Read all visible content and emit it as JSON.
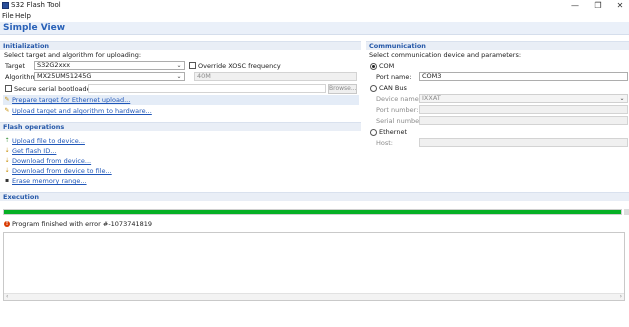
{
  "window": {
    "title": "S32 Flash Tool",
    "min": "—",
    "max": "❐",
    "close": "✕"
  },
  "menu": [
    {
      "label": "File"
    },
    {
      "label": "Help"
    }
  ],
  "view_title": "Simple View",
  "initialization": {
    "header": "Initialization",
    "subtitle": "Select target and algorithm for uploading:",
    "target_label": "Target",
    "target_value": "S32G2xxx",
    "override_label": "Override XOSC frequency",
    "override_checked": false,
    "algorithm_label": "Algorithm",
    "algorithm_value": "MX25UM51245G",
    "freq_value": "40M",
    "secure_label": "Secure serial bootloader:",
    "secure_checked": false,
    "browse_label": "Browse...",
    "link_ethernet": "Prepare target for Ethernet upload...",
    "link_upload": "Upload target and algorithm to hardware..."
  },
  "flash_operations": {
    "header": "Flash operations",
    "items": [
      {
        "label": "Upload file to device...",
        "icon": "upload-icon"
      },
      {
        "label": "Get flash ID...",
        "icon": "info-icon"
      },
      {
        "label": "Download from device...",
        "icon": "download-icon"
      },
      {
        "label": "Download from device to file...",
        "icon": "download-file-icon"
      },
      {
        "label": "Erase memory range...",
        "icon": "erase-icon"
      }
    ]
  },
  "communication": {
    "header": "Communication",
    "subtitle": "Select communication device and parameters:",
    "com_label": "COM",
    "com_selected": true,
    "port_name_label": "Port name:",
    "port_name_value": "COM3",
    "can_label": "CAN Bus",
    "device_name_label": "Device name:",
    "device_name_value": "IXXAT",
    "port_number_label": "Port number:",
    "serial_number_label": "Serial number:",
    "ethernet_label": "Ethernet",
    "host_label": "Host:"
  },
  "execution": {
    "header": "Execution",
    "progress_fraction": 1.0,
    "status_text": "Program finished with error #-1073741819"
  },
  "colors": {
    "accent": "#2457a8",
    "progress": "#06b025",
    "error": "#d83b01"
  }
}
